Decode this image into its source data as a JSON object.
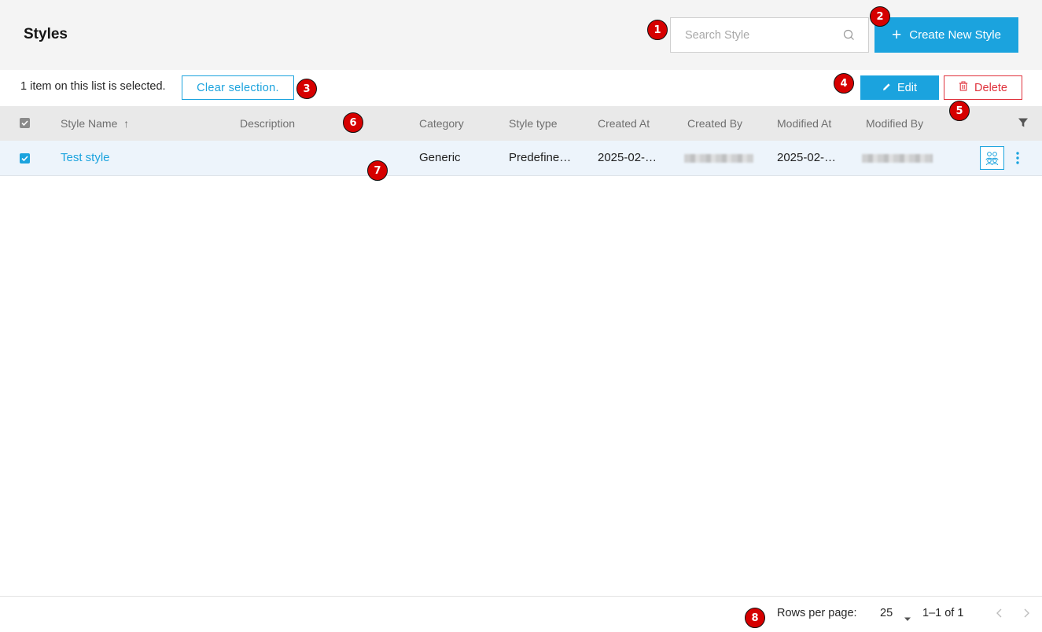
{
  "header": {
    "title": "Styles",
    "search_placeholder": "Search Style",
    "create_button_label": "Create New Style"
  },
  "selection_bar": {
    "selected_text": "1 item on this list is selected.",
    "clear_selection_label": "Clear selection.",
    "edit_label": "Edit",
    "delete_label": "Delete"
  },
  "table": {
    "columns": [
      "Style Name",
      "Description",
      "Category",
      "Style type",
      "Created At",
      "Created By",
      "Modified At",
      "Modified By"
    ],
    "sort_indicator": "↑",
    "rows": [
      {
        "style_name": "Test style",
        "description": "",
        "category": "Generic",
        "style_type": "Predefine…",
        "created_at": "2025-02-…",
        "created_by": "",
        "modified_at": "2025-02-…",
        "modified_by": "",
        "selected": true
      }
    ]
  },
  "footer": {
    "rows_per_page_label": "Rows per page:",
    "rows_per_page_value": "25",
    "range_text": "1–1 of 1"
  },
  "markers": [
    "1",
    "2",
    "3",
    "4",
    "5",
    "6",
    "7",
    "8"
  ],
  "colors": {
    "accent": "#1ba3de",
    "danger": "#e0323c",
    "marker": "#d60000",
    "header_bg": "#f4f4f4",
    "selected_row_bg": "#edf4fb"
  },
  "icons": [
    "search-icon",
    "plus-icon",
    "pencil-icon",
    "trash-icon",
    "filter-icon",
    "check-icon",
    "group-icon",
    "kebab-icon",
    "caret-down-icon",
    "chevron-left-icon",
    "chevron-right-icon"
  ]
}
